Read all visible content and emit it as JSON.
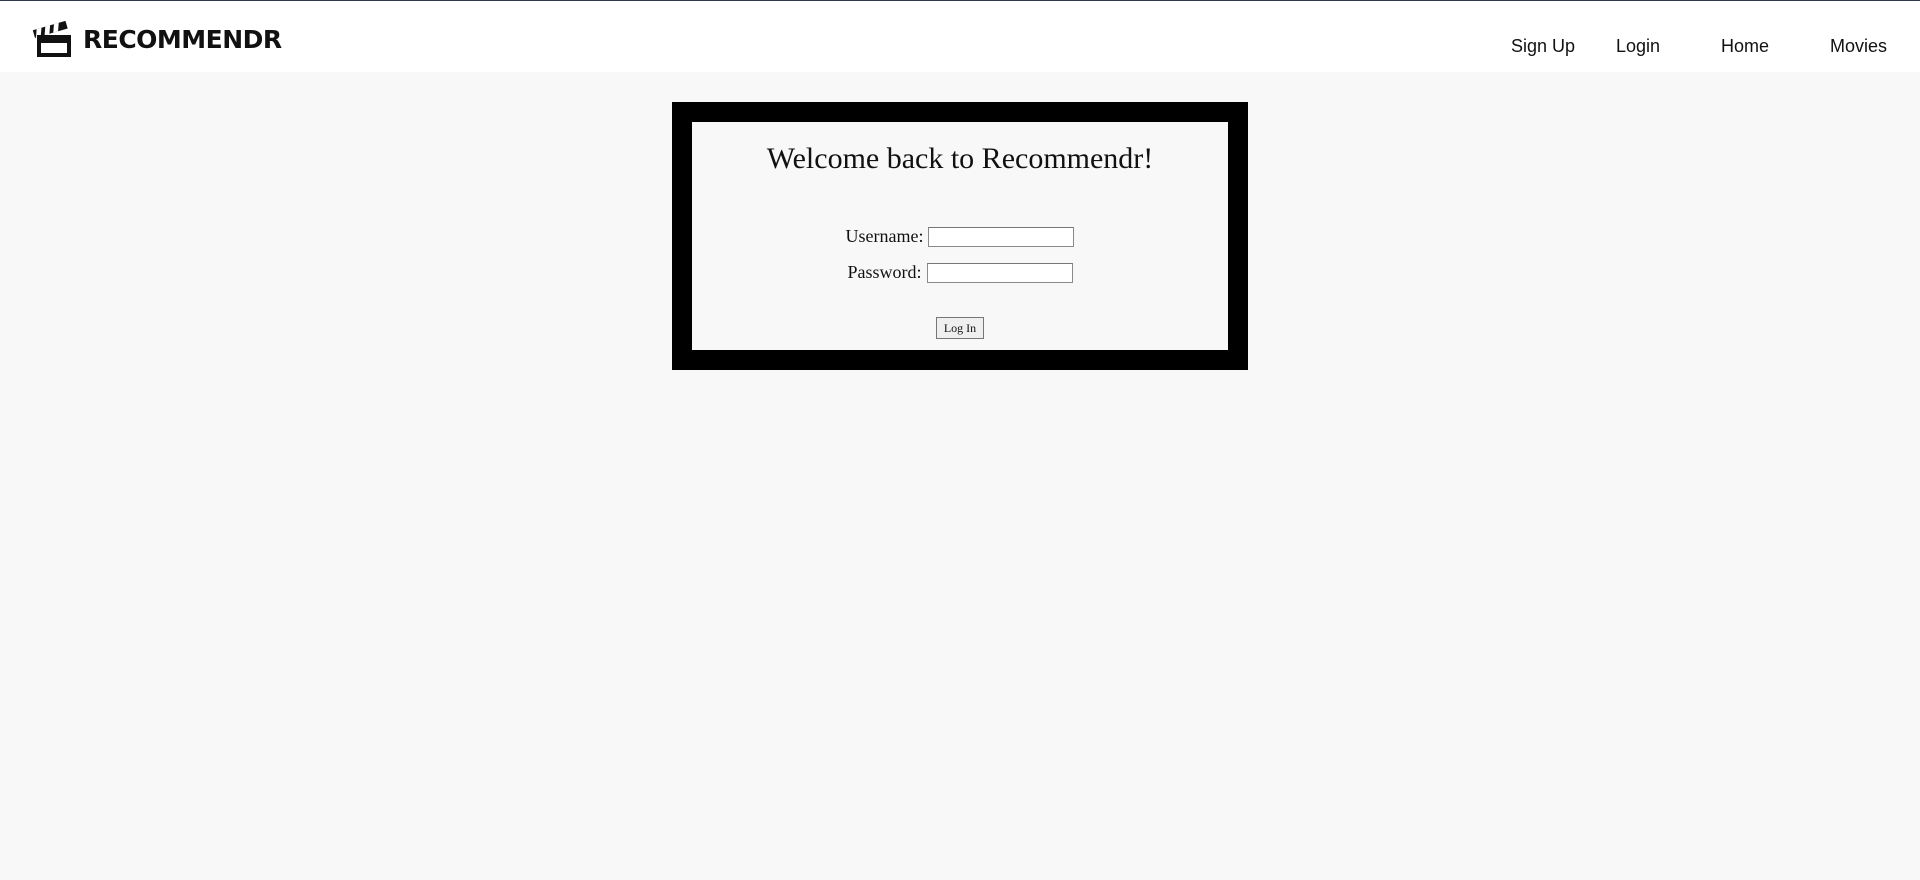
{
  "brand": {
    "name": "RECOMMENDR",
    "logo_icon": "clapperboard-icon"
  },
  "nav": {
    "signup": "Sign Up",
    "login": "Login",
    "home": "Home",
    "movies": "Movies"
  },
  "login_form": {
    "heading": "Welcome back to Recommendr!",
    "username_label": "Username:",
    "username_value": "",
    "password_label": "Password:",
    "password_value": "",
    "submit_label": "Log In"
  },
  "colors": {
    "page_background": "#f8f8f8",
    "frame": "#000000",
    "header_background": "#ffffff"
  }
}
